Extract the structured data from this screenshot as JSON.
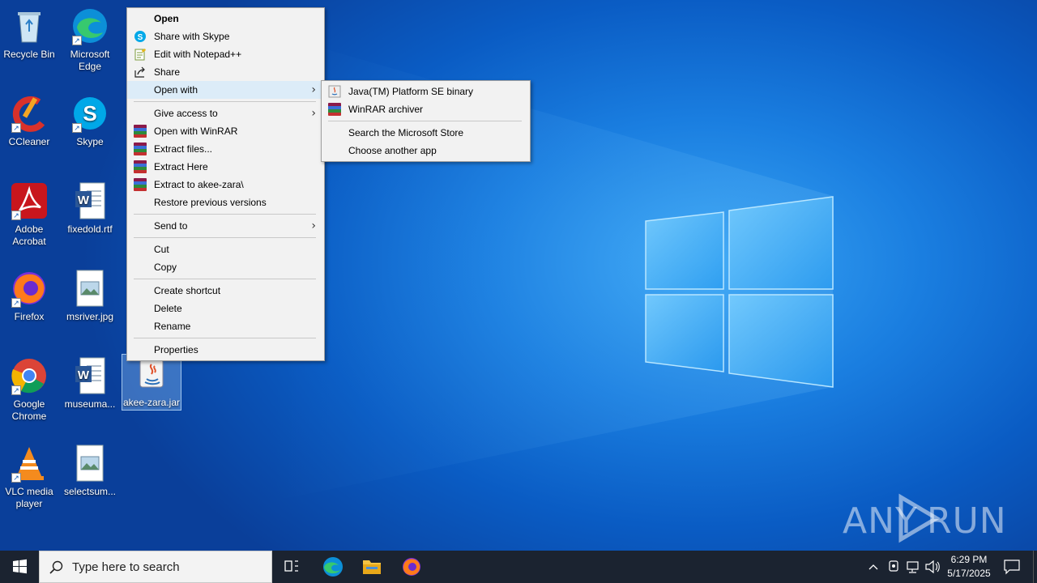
{
  "desktop": {
    "icons": [
      {
        "label": "Recycle Bin",
        "icon": "recycle-bin-icon"
      },
      {
        "label": "Microsoft Edge",
        "icon": "edge-icon"
      },
      {
        "label": "CCleaner",
        "icon": "ccleaner-icon"
      },
      {
        "label": "Skype",
        "icon": "skype-icon"
      },
      {
        "label": "Adobe Acrobat",
        "icon": "acrobat-icon"
      },
      {
        "label": "fixedold.rtf",
        "icon": "word-doc-icon"
      },
      {
        "label": "Firefox",
        "icon": "firefox-icon"
      },
      {
        "label": "msriver.jpg",
        "icon": "image-file-icon"
      },
      {
        "label": "Google Chrome",
        "icon": "chrome-icon"
      },
      {
        "label": "museuma...",
        "icon": "word-doc-icon"
      },
      {
        "label": "akee-zara.jar",
        "icon": "java-jar-icon"
      },
      {
        "label": "VLC media player",
        "icon": "vlc-icon"
      },
      {
        "label": "selectsum...",
        "icon": "image-file-icon"
      }
    ]
  },
  "context_menu": {
    "items": [
      {
        "label": "Open"
      },
      {
        "label": "Share with Skype"
      },
      {
        "label": "Edit with Notepad++"
      },
      {
        "label": "Share"
      },
      {
        "label": "Open with"
      },
      {
        "label": "Give access to"
      },
      {
        "label": "Open with WinRAR"
      },
      {
        "label": "Extract files..."
      },
      {
        "label": "Extract Here"
      },
      {
        "label": "Extract to akee-zara\\"
      },
      {
        "label": "Restore previous versions"
      },
      {
        "label": "Send to"
      },
      {
        "label": "Cut"
      },
      {
        "label": "Copy"
      },
      {
        "label": "Create shortcut"
      },
      {
        "label": "Delete"
      },
      {
        "label": "Rename"
      },
      {
        "label": "Properties"
      }
    ]
  },
  "submenu": {
    "items": [
      {
        "label": "Java(TM) Platform SE binary"
      },
      {
        "label": "WinRAR archiver"
      },
      {
        "label": "Search the Microsoft Store"
      },
      {
        "label": "Choose another app"
      }
    ]
  },
  "taskbar": {
    "search_placeholder": "Type here to search",
    "time": "6:29 PM",
    "date": "5/17/2025"
  },
  "watermark": "ANY RUN",
  "colors": {
    "accent": "#0078d7",
    "taskbar": "#1b2330",
    "menu_bg": "#f2f2f2",
    "menu_hover": "#dcecf8"
  }
}
